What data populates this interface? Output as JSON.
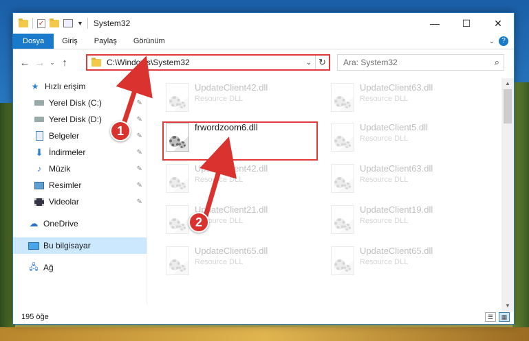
{
  "window": {
    "title": "System32",
    "controls": {
      "minimize": "—",
      "maximize": "☐",
      "close": "✕"
    }
  },
  "ribbon": {
    "tabs": [
      "Dosya",
      "Giriş",
      "Paylaş",
      "Görünüm"
    ],
    "help": "?"
  },
  "navigation": {
    "address": "C:\\Windows\\System32",
    "search_placeholder": "Ara: System32"
  },
  "sidebar": {
    "items": [
      {
        "label": "Hızlı erişim",
        "icon": "star-icon"
      },
      {
        "label": "Yerel Disk (C:)",
        "icon": "drive-icon",
        "pinned": true
      },
      {
        "label": "Yerel Disk (D:)",
        "icon": "drive-icon",
        "pinned": true
      },
      {
        "label": "Belgeler",
        "icon": "document-icon",
        "pinned": true
      },
      {
        "label": "İndirmeler",
        "icon": "download-icon",
        "pinned": true
      },
      {
        "label": "Müzik",
        "icon": "music-icon",
        "pinned": true
      },
      {
        "label": "Resimler",
        "icon": "pictures-icon",
        "pinned": true
      },
      {
        "label": "Videolar",
        "icon": "videos-icon",
        "pinned": true
      },
      {
        "label": "OneDrive",
        "icon": "cloud-icon"
      },
      {
        "label": "Bu bilgisayar",
        "icon": "computer-icon",
        "selected": true
      },
      {
        "label": "Ağ",
        "icon": "network-icon"
      }
    ]
  },
  "files": [
    {
      "name": "UpdateClient42.dll",
      "type": "Resource DLL"
    },
    {
      "name": "UpdateClient63.dll",
      "type": "Resource DLL"
    },
    {
      "name": "frwordzoom6.dll",
      "type": ""
    },
    {
      "name": "UpdateClient5.dll",
      "type": "Resource DLL"
    },
    {
      "name": "UpdateClient42.dll",
      "type": "Resource DLL"
    },
    {
      "name": "UpdateClient63.dll",
      "type": "Resource DLL"
    },
    {
      "name": "UpdateClient21.dll",
      "type": "Resource DLL"
    },
    {
      "name": "UpdateClient19.dll",
      "type": "Resource DLL"
    },
    {
      "name": "UpdateClient65.dll",
      "type": "Resource DLL"
    },
    {
      "name": "UpdateClient65.dll",
      "type": "Resource DLL"
    }
  ],
  "status": {
    "item_count": "195 öğe"
  },
  "callouts": {
    "step1": "1",
    "step2": "2"
  },
  "colors": {
    "accent": "#1979ca",
    "highlight": "#e03a3a",
    "selected_bg": "#cce8ff"
  }
}
